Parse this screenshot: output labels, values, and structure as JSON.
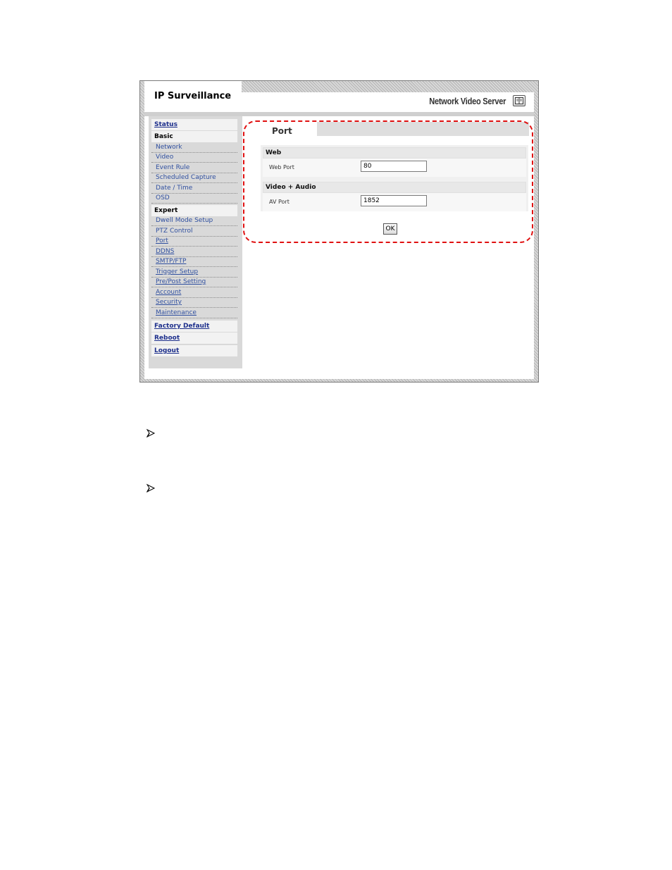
{
  "header": {
    "app_title": "IP Surveillance",
    "product_name": "Network Video Server",
    "manual_icon": "book-icon"
  },
  "sidebar": {
    "status": "Status",
    "basic": {
      "label": "Basic",
      "items": [
        "Network",
        "Video",
        "Event Rule",
        "Scheduled Capture",
        "Date / Time",
        "OSD"
      ]
    },
    "expert": {
      "label": "Expert",
      "items": [
        "Dwell Mode Setup",
        "PTZ Control",
        "Port",
        "DDNS",
        "SMTP/FTP",
        "Trigger Setup",
        "Pre/Post Setting",
        "Account",
        "Security",
        "Maintenance"
      ]
    },
    "factory_default": "Factory Default",
    "reboot": "Reboot",
    "logout": "Logout"
  },
  "main": {
    "tab_label": "Port",
    "sections": [
      {
        "title": "Web",
        "field_label": "Web Port",
        "field_value": "80"
      },
      {
        "title": "Video + Audio",
        "field_label": "AV Port",
        "field_value": "1852"
      }
    ],
    "ok_label": "OK"
  },
  "colors": {
    "highlight": "#e01010",
    "link": "#2a3f9a"
  },
  "icons": {
    "bullets": [
      "arrow-bullet-icon",
      "arrow-bullet-icon"
    ]
  }
}
